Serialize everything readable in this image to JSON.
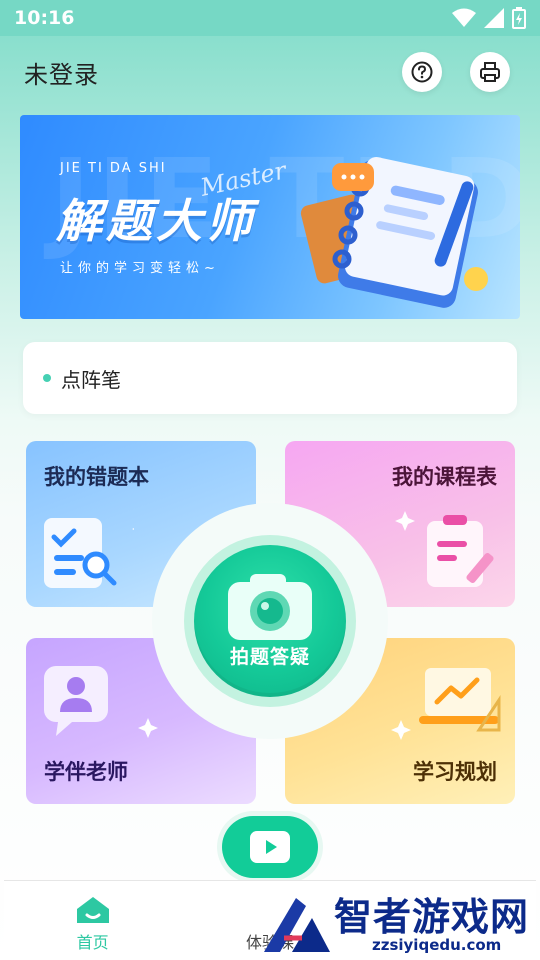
{
  "status_bar": {
    "time": "10:16"
  },
  "header": {
    "title": "未登录"
  },
  "banner": {
    "subtitle": "JIE TI DA SHI",
    "title": "解题大师",
    "script": "Master",
    "slogan": "让你的学习变轻松~"
  },
  "pen": {
    "label": "点阵笔"
  },
  "tiles": {
    "wrong_book": "我的错题本",
    "course_table": "我的课程表",
    "teacher": "学伴老师",
    "study_plan": "学习规划"
  },
  "center": {
    "label": "拍题答疑"
  },
  "bottom_nav": [
    {
      "label": "首页"
    },
    {
      "label": "体验课"
    }
  ],
  "watermark": {
    "text": "智者游戏网",
    "url": "zzsiyiqedu.com"
  },
  "colors": {
    "accent": "#2dc8a2",
    "primary_green": "#14c998"
  }
}
